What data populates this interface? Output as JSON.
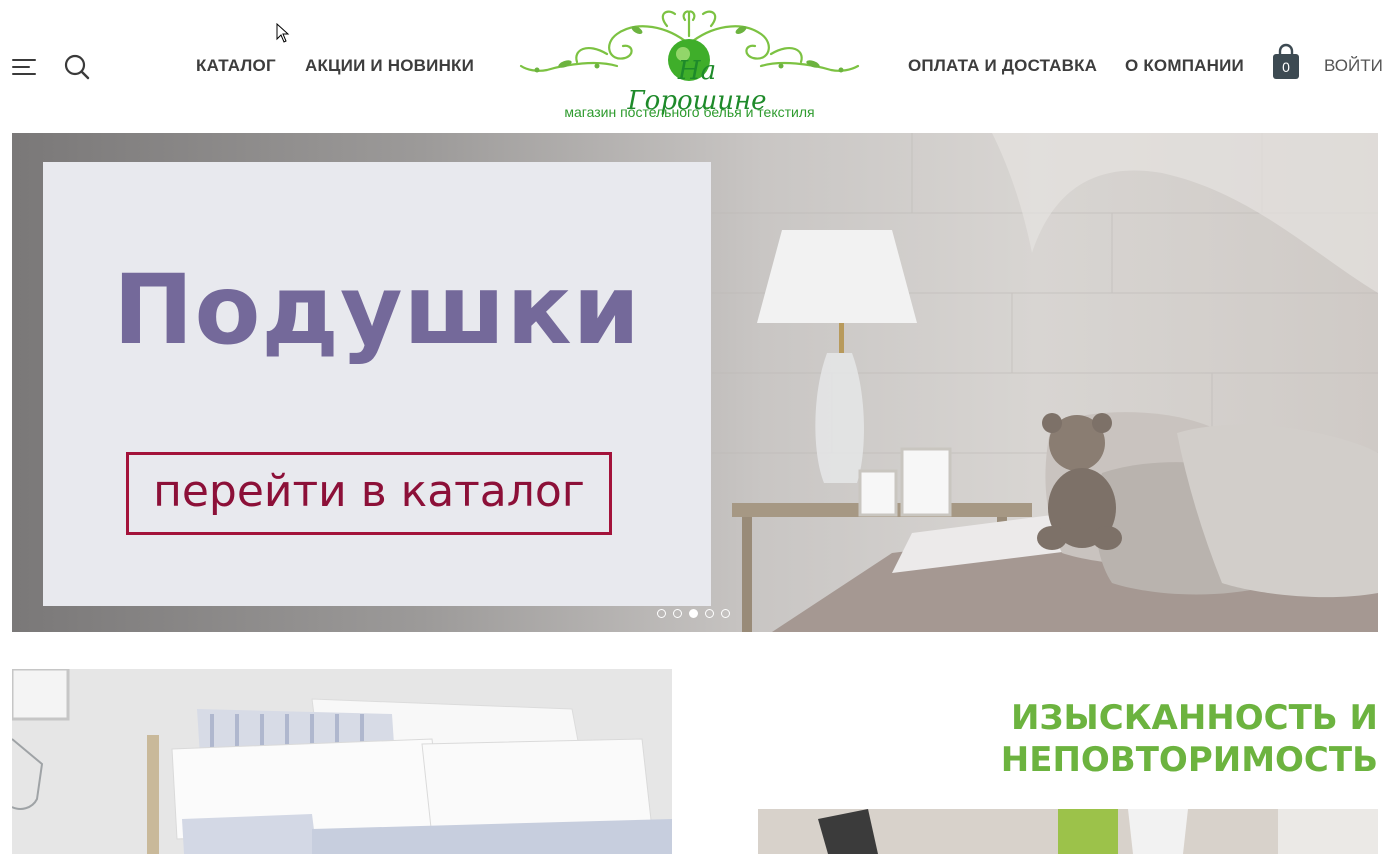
{
  "header": {
    "nav_left": [
      "КАТАЛОГ",
      "АКЦИИ И НОВИНКИ"
    ],
    "nav_right": [
      "ОПЛАТА И ДОСТАВКА",
      "О КОМПАНИИ"
    ],
    "logo_name": "На Горошине",
    "logo_tagline": "магазин постельного белья и текстиля",
    "cart_count": "0",
    "login_label": "ВОЙТИ"
  },
  "hero": {
    "title": "Подушки",
    "button_label": "перейти в каталог",
    "slides_total": 5,
    "active_slide": 3
  },
  "section": {
    "slogan_line1": "ИЗЫСКАННОСТЬ И",
    "slogan_line2": "НЕПОВТОРИМОСТЬ"
  },
  "colors": {
    "brand_green": "#6cb33f",
    "logo_green": "#2e9b2e",
    "hero_title": "#74699a",
    "hero_button": "#8c1038",
    "nav_text": "#3d3d3d"
  },
  "icons": [
    "menu-icon",
    "search-icon",
    "cart-icon"
  ]
}
